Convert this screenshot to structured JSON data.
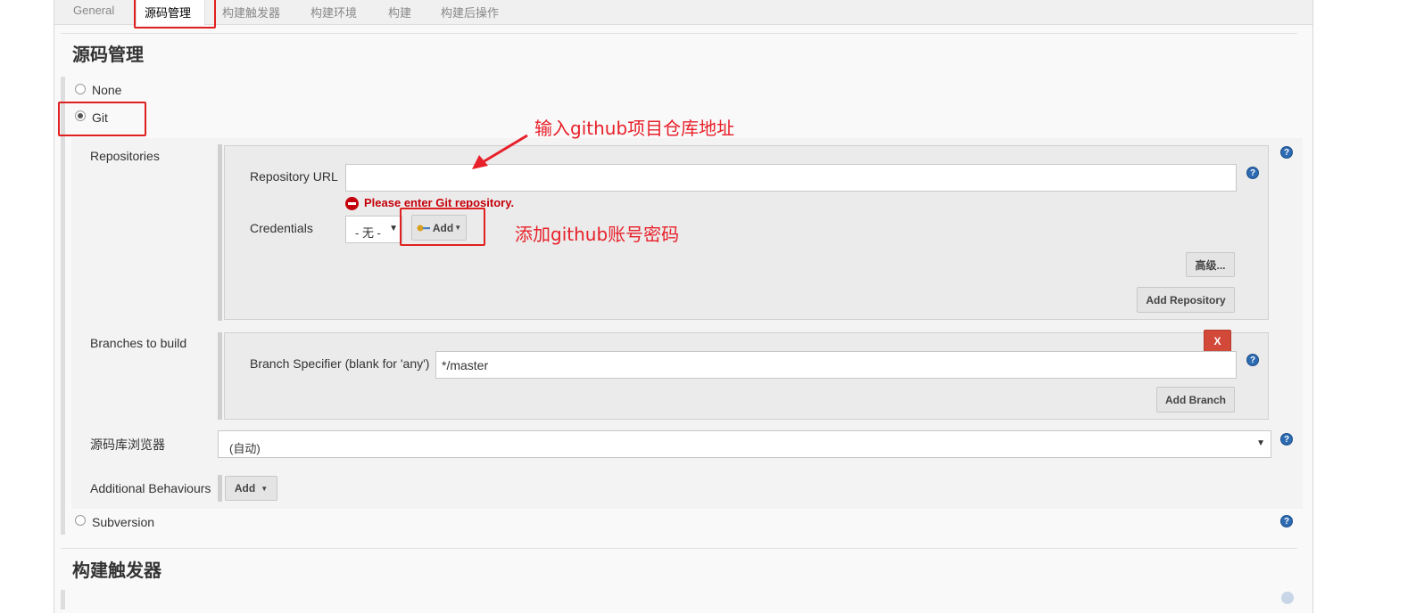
{
  "tabs": [
    "General",
    "源码管理",
    "构建触发器",
    "构建环境",
    "构建",
    "构建后操作"
  ],
  "section_title": "源码管理",
  "next_section_title": "构建触发器",
  "scm_options": {
    "none": "None",
    "git": "Git",
    "subversion": "Subversion"
  },
  "repositories": {
    "label": "Repositories",
    "url_label": "Repository URL",
    "url_value": "",
    "error": "Please enter Git repository.",
    "credentials_label": "Credentials",
    "credentials_value": "- 无 -",
    "add_button": "Add",
    "advanced_button": "高级...",
    "add_repository_button": "Add Repository"
  },
  "branches": {
    "label": "Branches to build",
    "specifier_label": "Branch Specifier (blank for 'any')",
    "specifier_value": "*/master",
    "delete_button": "X",
    "add_branch_button": "Add Branch"
  },
  "browser": {
    "label": "源码库浏览器",
    "value": "(自动)"
  },
  "behaviours": {
    "label": "Additional Behaviours",
    "add_button": "Add"
  },
  "annotations": {
    "repo_url_note": "输入github项目仓库地址",
    "credentials_note": "添加github账号密码"
  },
  "colors": {
    "annotation_red": "#e8202a",
    "error_red": "#c4000a",
    "help_blue": "#2c6ab2",
    "delete_red": "#d24939"
  }
}
